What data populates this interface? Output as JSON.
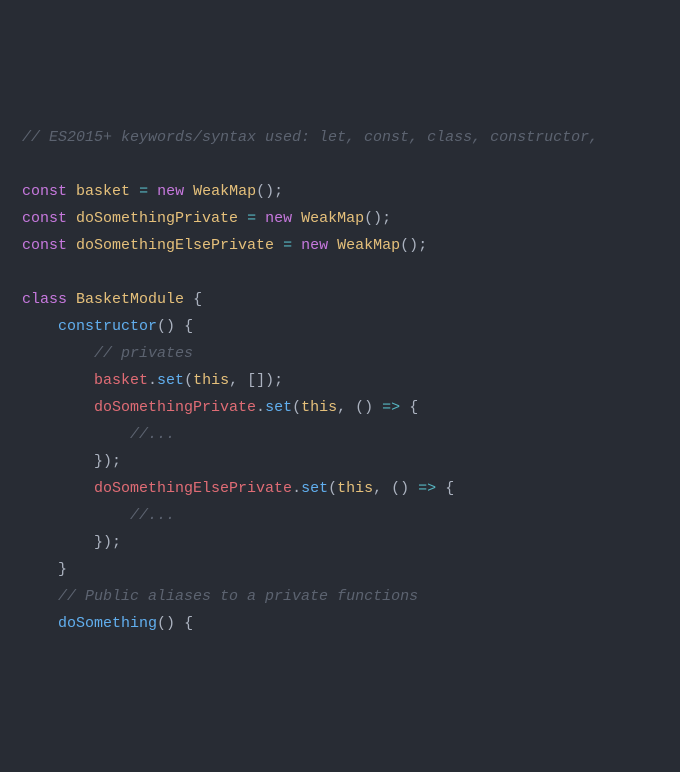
{
  "code": {
    "lines": [
      [
        {
          "cls": "tok-comment",
          "text": "// ES2015+ keywords/syntax used: let, const, class, constructor,"
        }
      ],
      [],
      [
        {
          "cls": "tok-keyword",
          "text": "const"
        },
        {
          "cls": "tok-default",
          "text": " "
        },
        {
          "cls": "tok-var",
          "text": "basket"
        },
        {
          "cls": "tok-default",
          "text": " "
        },
        {
          "cls": "tok-op",
          "text": "="
        },
        {
          "cls": "tok-default",
          "text": " "
        },
        {
          "cls": "tok-keyword",
          "text": "new"
        },
        {
          "cls": "tok-default",
          "text": " "
        },
        {
          "cls": "tok-class",
          "text": "WeakMap"
        },
        {
          "cls": "tok-paren",
          "text": "()"
        },
        {
          "cls": "tok-punct",
          "text": ";"
        }
      ],
      [
        {
          "cls": "tok-keyword",
          "text": "const"
        },
        {
          "cls": "tok-default",
          "text": " "
        },
        {
          "cls": "tok-var",
          "text": "doSomethingPrivate"
        },
        {
          "cls": "tok-default",
          "text": " "
        },
        {
          "cls": "tok-op",
          "text": "="
        },
        {
          "cls": "tok-default",
          "text": " "
        },
        {
          "cls": "tok-keyword",
          "text": "new"
        },
        {
          "cls": "tok-default",
          "text": " "
        },
        {
          "cls": "tok-class",
          "text": "WeakMap"
        },
        {
          "cls": "tok-paren",
          "text": "()"
        },
        {
          "cls": "tok-punct",
          "text": ";"
        }
      ],
      [
        {
          "cls": "tok-keyword",
          "text": "const"
        },
        {
          "cls": "tok-default",
          "text": " "
        },
        {
          "cls": "tok-var",
          "text": "doSomethingElsePrivate"
        },
        {
          "cls": "tok-default",
          "text": " "
        },
        {
          "cls": "tok-op",
          "text": "="
        },
        {
          "cls": "tok-default",
          "text": " "
        },
        {
          "cls": "tok-keyword",
          "text": "new"
        },
        {
          "cls": "tok-default",
          "text": " "
        },
        {
          "cls": "tok-class",
          "text": "WeakMap"
        },
        {
          "cls": "tok-paren",
          "text": "()"
        },
        {
          "cls": "tok-punct",
          "text": ";"
        }
      ],
      [],
      [
        {
          "cls": "tok-keyword",
          "text": "class"
        },
        {
          "cls": "tok-default",
          "text": " "
        },
        {
          "cls": "tok-class",
          "text": "BasketModule"
        },
        {
          "cls": "tok-default",
          "text": " "
        },
        {
          "cls": "tok-brace",
          "text": "{"
        }
      ],
      [
        {
          "cls": "tok-default",
          "text": "    "
        },
        {
          "cls": "tok-func",
          "text": "constructor"
        },
        {
          "cls": "tok-paren",
          "text": "()"
        },
        {
          "cls": "tok-default",
          "text": " "
        },
        {
          "cls": "tok-brace",
          "text": "{"
        }
      ],
      [
        {
          "cls": "tok-default",
          "text": "        "
        },
        {
          "cls": "tok-comment",
          "text": "// privates"
        }
      ],
      [
        {
          "cls": "tok-default",
          "text": "        "
        },
        {
          "cls": "tok-ident",
          "text": "basket"
        },
        {
          "cls": "tok-punct",
          "text": "."
        },
        {
          "cls": "tok-method",
          "text": "set"
        },
        {
          "cls": "tok-paren",
          "text": "("
        },
        {
          "cls": "tok-this",
          "text": "this"
        },
        {
          "cls": "tok-punct",
          "text": ", "
        },
        {
          "cls": "tok-bracket",
          "text": "[]"
        },
        {
          "cls": "tok-paren",
          "text": ")"
        },
        {
          "cls": "tok-punct",
          "text": ";"
        }
      ],
      [
        {
          "cls": "tok-default",
          "text": "        "
        },
        {
          "cls": "tok-ident",
          "text": "doSomethingPrivate"
        },
        {
          "cls": "tok-punct",
          "text": "."
        },
        {
          "cls": "tok-method",
          "text": "set"
        },
        {
          "cls": "tok-paren",
          "text": "("
        },
        {
          "cls": "tok-this",
          "text": "this"
        },
        {
          "cls": "tok-punct",
          "text": ", "
        },
        {
          "cls": "tok-paren",
          "text": "()"
        },
        {
          "cls": "tok-default",
          "text": " "
        },
        {
          "cls": "tok-op",
          "text": "=>"
        },
        {
          "cls": "tok-default",
          "text": " "
        },
        {
          "cls": "tok-brace",
          "text": "{"
        }
      ],
      [
        {
          "cls": "tok-default",
          "text": "            "
        },
        {
          "cls": "tok-comment",
          "text": "//..."
        }
      ],
      [
        {
          "cls": "tok-default",
          "text": "        "
        },
        {
          "cls": "tok-brace",
          "text": "}"
        },
        {
          "cls": "tok-paren",
          "text": ")"
        },
        {
          "cls": "tok-punct",
          "text": ";"
        }
      ],
      [
        {
          "cls": "tok-default",
          "text": "        "
        },
        {
          "cls": "tok-ident",
          "text": "doSomethingElsePrivate"
        },
        {
          "cls": "tok-punct",
          "text": "."
        },
        {
          "cls": "tok-method",
          "text": "set"
        },
        {
          "cls": "tok-paren",
          "text": "("
        },
        {
          "cls": "tok-this",
          "text": "this"
        },
        {
          "cls": "tok-punct",
          "text": ", "
        },
        {
          "cls": "tok-paren",
          "text": "()"
        },
        {
          "cls": "tok-default",
          "text": " "
        },
        {
          "cls": "tok-op",
          "text": "=>"
        },
        {
          "cls": "tok-default",
          "text": " "
        },
        {
          "cls": "tok-brace",
          "text": "{"
        }
      ],
      [
        {
          "cls": "tok-default",
          "text": "            "
        },
        {
          "cls": "tok-comment",
          "text": "//..."
        }
      ],
      [
        {
          "cls": "tok-default",
          "text": "        "
        },
        {
          "cls": "tok-brace",
          "text": "}"
        },
        {
          "cls": "tok-paren",
          "text": ")"
        },
        {
          "cls": "tok-punct",
          "text": ";"
        }
      ],
      [
        {
          "cls": "tok-default",
          "text": "    "
        },
        {
          "cls": "tok-brace",
          "text": "}"
        }
      ],
      [
        {
          "cls": "tok-default",
          "text": "    "
        },
        {
          "cls": "tok-comment",
          "text": "// Public aliases to a private functions"
        }
      ],
      [
        {
          "cls": "tok-default",
          "text": "    "
        },
        {
          "cls": "tok-func",
          "text": "doSomething"
        },
        {
          "cls": "tok-paren",
          "text": "()"
        },
        {
          "cls": "tok-default",
          "text": " "
        },
        {
          "cls": "tok-brace",
          "text": "{"
        }
      ]
    ]
  }
}
